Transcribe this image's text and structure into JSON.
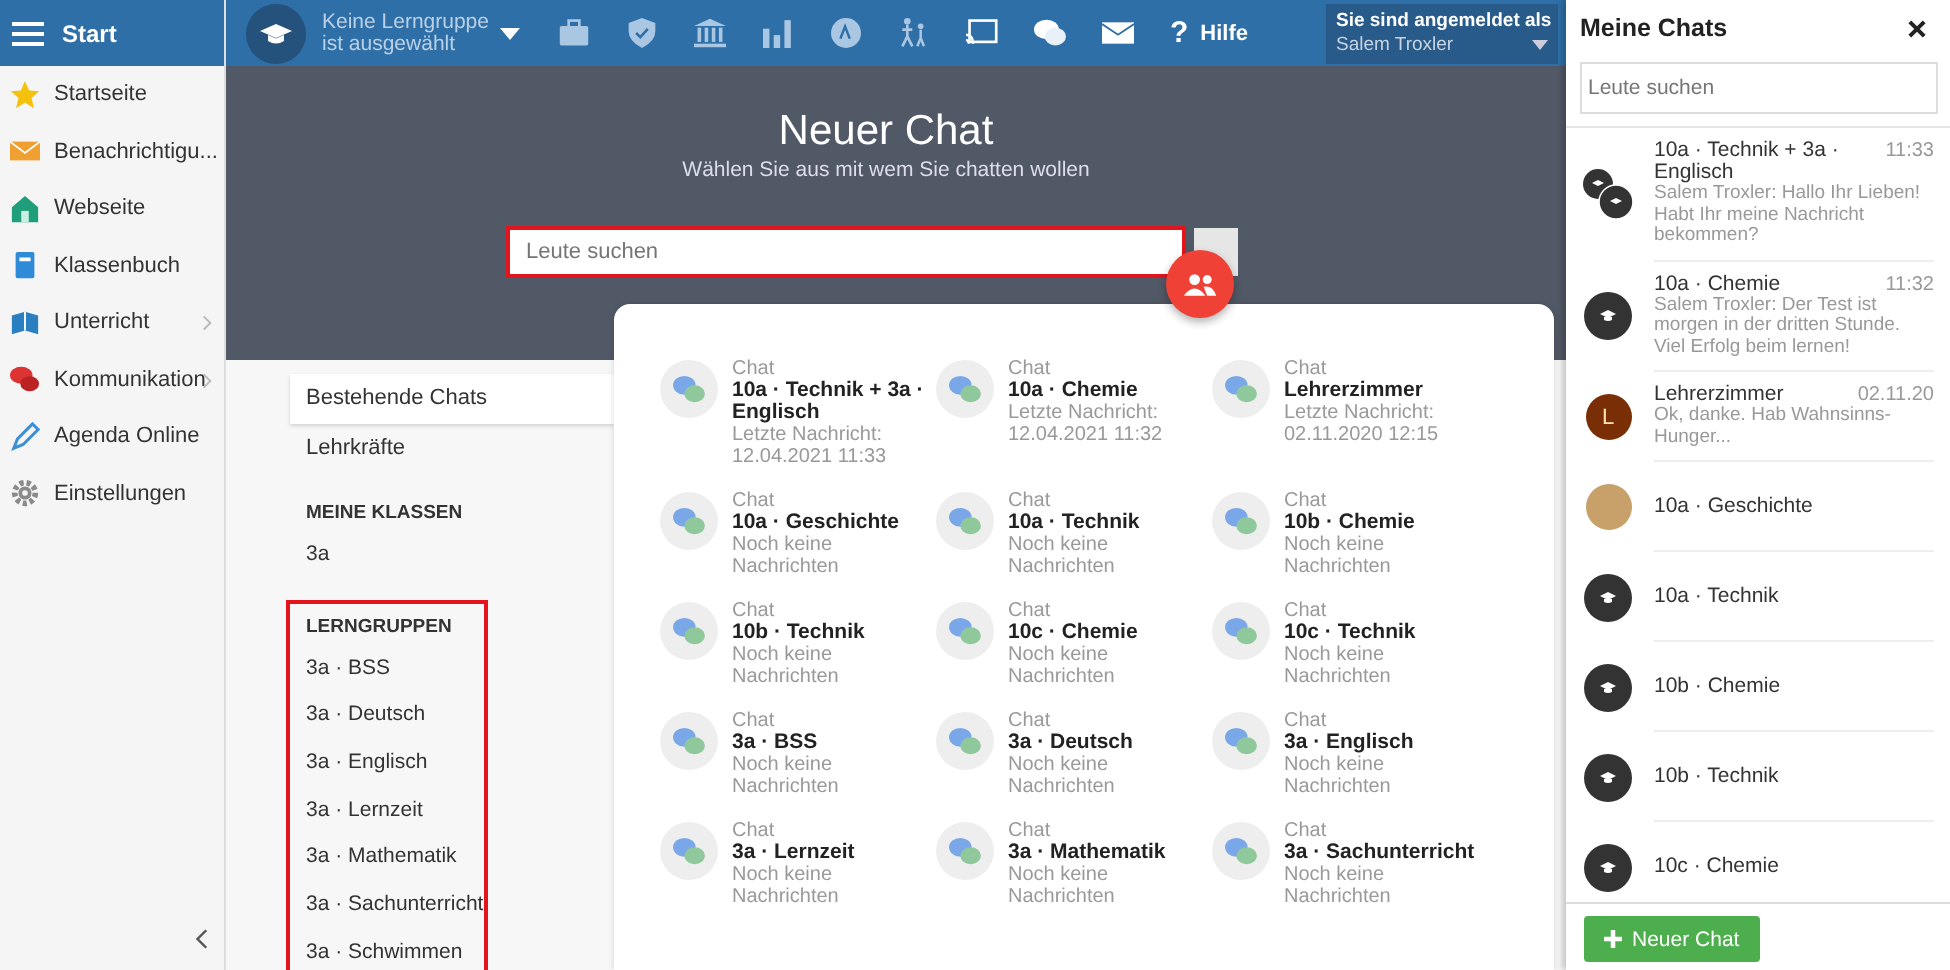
{
  "topbar": {
    "app_title": "Start",
    "group_selector": {
      "line1": "Keine Lerngruppe",
      "line2": "ist ausgewählt"
    },
    "help_icon": "?",
    "help_label": "Hilfe",
    "login": {
      "label": "Sie sind angemeldet als",
      "user": "Salem Troxler"
    }
  },
  "sidebar": {
    "items": [
      {
        "kind": "star",
        "label": "Startseite",
        "has_submenu": false
      },
      {
        "kind": "mail",
        "label": "Benachrichtigu...",
        "has_submenu": false
      },
      {
        "kind": "house",
        "label": "Webseite",
        "has_submenu": false
      },
      {
        "kind": "book",
        "label": "Klassenbuch",
        "has_submenu": false
      },
      {
        "kind": "openbook",
        "label": "Unterricht",
        "has_submenu": true
      },
      {
        "kind": "chat",
        "label": "Kommunikation",
        "has_submenu": true
      },
      {
        "kind": "pen",
        "label": "Agenda Online",
        "has_submenu": false
      },
      {
        "kind": "gear",
        "label": "Einstellungen",
        "has_submenu": false
      }
    ]
  },
  "main": {
    "title": "Neuer Chat",
    "subtitle": "Wählen Sie aus mit wem Sie chatten wollen",
    "search": {
      "placeholder": "Leute suchen",
      "highlighted": true
    },
    "tabs": [
      {
        "label": "Bestehende Chats",
        "selected": true
      },
      {
        "label": "Lehrkräfte",
        "selected": false
      }
    ],
    "sections": [
      {
        "heading": "MEINE KLASSEN",
        "highlighted": false,
        "items": [
          "3a"
        ]
      },
      {
        "heading": "LERNGRUPPEN",
        "highlighted": true,
        "items": [
          "3a · BSS",
          "3a · Deutsch",
          "3a · Englisch",
          "3a · Lernzeit",
          "3a · Mathematik",
          "3a · Sachunterricht",
          "3a · Schwimmen"
        ]
      }
    ],
    "chats": [
      {
        "type_label": "Chat",
        "name": "10a · Technik + 3a · Englisch",
        "info": "Letzte Nachricht: 12.04.2021 11:33"
      },
      {
        "type_label": "Chat",
        "name": "10a · Chemie",
        "info": "Letzte Nachricht: 12.04.2021 11:32"
      },
      {
        "type_label": "Chat",
        "name": "Lehrerzimmer",
        "info": "Letzte Nachricht: 02.11.2020 12:15"
      },
      {
        "type_label": "Chat",
        "name": "10a · Geschichte",
        "info": "Noch keine Nachrichten"
      },
      {
        "type_label": "Chat",
        "name": "10a · Technik",
        "info": "Noch keine Nachrichten"
      },
      {
        "type_label": "Chat",
        "name": "10b · Chemie",
        "info": "Noch keine Nachrichten"
      },
      {
        "type_label": "Chat",
        "name": "10b · Technik",
        "info": "Noch keine Nachrichten"
      },
      {
        "type_label": "Chat",
        "name": "10c · Chemie",
        "info": "Noch keine Nachrichten"
      },
      {
        "type_label": "Chat",
        "name": "10c · Technik",
        "info": "Noch keine Nachrichten"
      },
      {
        "type_label": "Chat",
        "name": "3a · BSS",
        "info": "Noch keine Nachrichten"
      },
      {
        "type_label": "Chat",
        "name": "3a · Deutsch",
        "info": "Noch keine Nachrichten"
      },
      {
        "type_label": "Chat",
        "name": "3a · Englisch",
        "info": "Noch keine Nachrichten"
      },
      {
        "type_label": "Chat",
        "name": "3a · Lernzeit",
        "info": "Noch keine Nachrichten"
      },
      {
        "type_label": "Chat",
        "name": "3a · Mathematik",
        "info": "Noch keine Nachrichten"
      },
      {
        "type_label": "Chat",
        "name": "3a · Sachunterricht",
        "info": "Noch keine Nachrichten"
      }
    ]
  },
  "chat_panel": {
    "title": "Meine Chats",
    "search": {
      "placeholder": "Leute suchen"
    },
    "chats": [
      {
        "kind": "group-pair",
        "name": "10a · Technik + 3a · Englisch",
        "time": "11:33",
        "preview": "Salem Troxler: Hallo Ihr Lieben! Habt Ihr meine Nachricht bekommen?"
      },
      {
        "kind": "group",
        "name": "10a · Chemie",
        "time": "11:32",
        "preview": "Salem Troxler: Der Test ist morgen in der dritten Stunde. Viel Erfolg beim lernen!"
      },
      {
        "kind": "letter",
        "avatar_letter": "L",
        "name": "Lehrerzimmer",
        "time": "02.11.20",
        "preview": "Ok, danke. Hab Wahnsinns-Hunger..."
      },
      {
        "kind": "photo",
        "name": "10a · Geschichte"
      },
      {
        "kind": "group",
        "name": "10a · Technik"
      },
      {
        "kind": "group",
        "name": "10b · Chemie"
      },
      {
        "kind": "group",
        "name": "10b · Technik"
      },
      {
        "kind": "group",
        "name": "10c · Chemie"
      }
    ],
    "new_chat_button": "Neuer Chat"
  }
}
